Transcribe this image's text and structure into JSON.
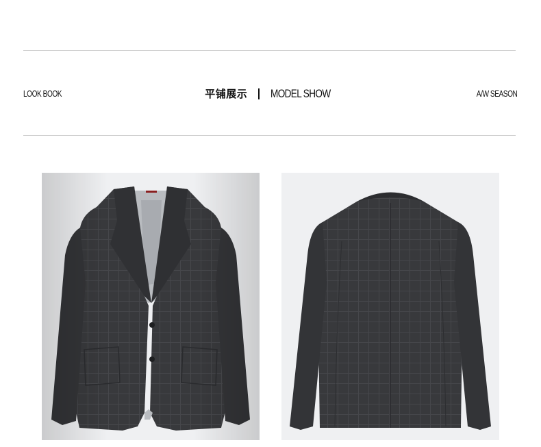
{
  "header": {
    "left_label": "LOOK BOOK",
    "title_cn": "平铺展示",
    "title_en": "MODEL SHOW",
    "right_label": "A/W SEASON"
  },
  "images": {
    "front": {
      "icon": "blazer-front-image",
      "background": "#eff0f2",
      "fabric": "#3a3b3e"
    },
    "back": {
      "icon": "blazer-back-image",
      "background": "#eff0f2",
      "fabric": "#3a3b3e"
    }
  }
}
